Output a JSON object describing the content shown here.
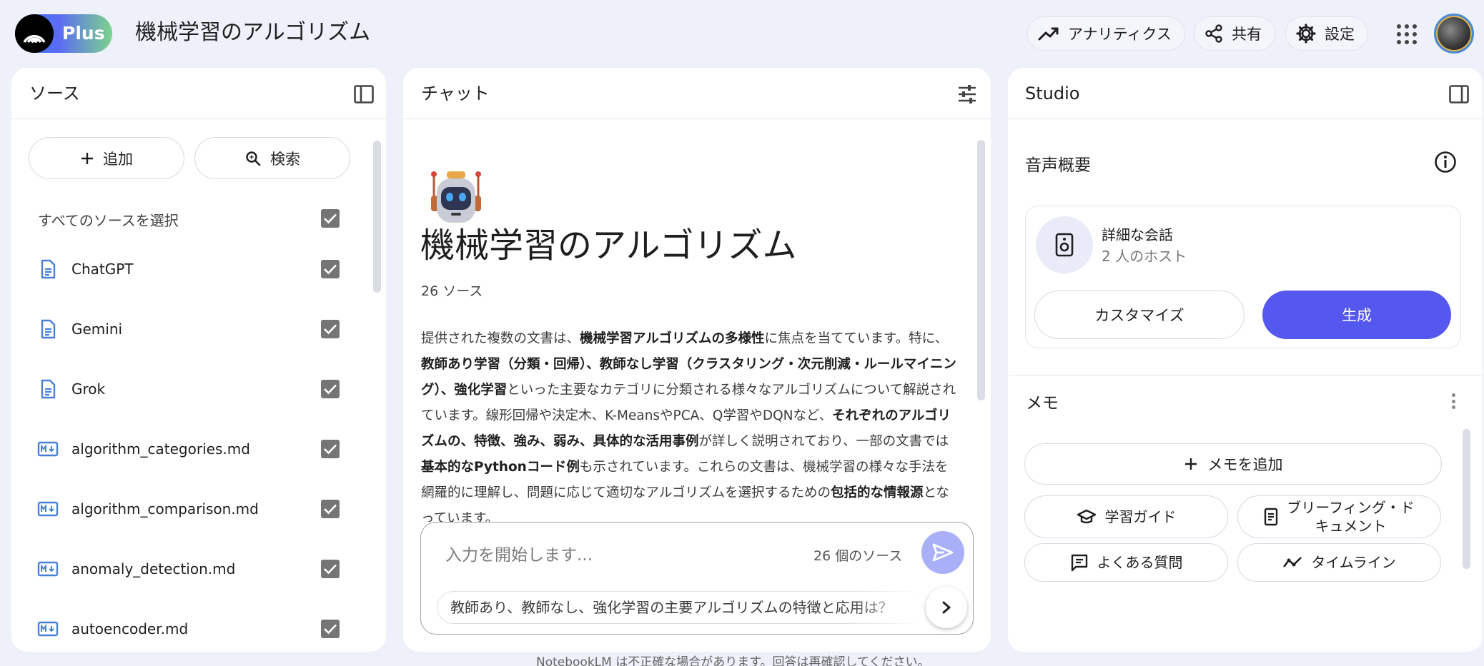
{
  "header": {
    "logo_text": "Plus",
    "title": "機械学習のアルゴリズム",
    "analytics_label": "アナリティクス",
    "share_label": "共有",
    "settings_label": "設定"
  },
  "sources": {
    "title": "ソース",
    "add_label": "追加",
    "search_label": "検索",
    "select_all_label": "すべてのソースを選択",
    "items": [
      {
        "name": "ChatGPT",
        "type": "doc"
      },
      {
        "name": "Gemini",
        "type": "doc"
      },
      {
        "name": "Grok",
        "type": "doc"
      },
      {
        "name": "algorithm_categories.md",
        "type": "md"
      },
      {
        "name": "algorithm_comparison.md",
        "type": "md"
      },
      {
        "name": "anomaly_detection.md",
        "type": "md"
      },
      {
        "name": "autoencoder.md",
        "type": "md"
      }
    ]
  },
  "chat": {
    "title": "チャット",
    "notebook_title": "機械学習のアルゴリズム",
    "source_count": "26 ソース",
    "summary": [
      {
        "t": "提供された複数の文書は、"
      },
      {
        "t": "機械学習アルゴリズムの多様性",
        "b": true
      },
      {
        "t": "に焦点を当てています。特に、"
      },
      {
        "t": "教師あり学習（分類・回帰）、教師なし学習（クラスタリング・次元削減・ルールマイニング）、強化学習",
        "b": true
      },
      {
        "t": "といった主要なカテゴリに分類される様々なアルゴリズムについて解説されています。線形回帰や決定木、K-MeansやPCA、Q学習やDQNなど、"
      },
      {
        "t": "それぞれのアルゴリズムの、特徴、強み、弱み、具体的な活用事例",
        "b": true
      },
      {
        "t": "が詳しく説明されており、一部の文書では"
      },
      {
        "t": "基本的なPythonコード例",
        "b": true
      },
      {
        "t": "も示されています。これらの文書は、機械学習の様々な手法を網羅的に理解し、問題に応じて適切なアルゴリズムを選択するための"
      },
      {
        "t": "包括的な情報源",
        "b": true
      },
      {
        "t": "となっています。"
      }
    ],
    "input_placeholder": "入力を開始します...",
    "input_source_count": "26 個のソース",
    "suggestion": "教師あり、教師なし、強化学習の主要アルゴリズムの特徴と応用は？",
    "footnote": "NotebookLM は不正確な場合があります。回答は再確認してください。"
  },
  "studio": {
    "title": "Studio",
    "audio_title": "音声概要",
    "audio_name": "詳細な会話",
    "audio_sub": "2 人のホスト",
    "customize_label": "カスタマイズ",
    "generate_label": "生成",
    "memo_title": "メモ",
    "add_memo_label": "メモを追加",
    "tools": {
      "study_guide": "学習ガイド",
      "briefing_line1": "ブリーフィング・ド",
      "briefing_line2": "キュメント",
      "faq": "よくある質問",
      "timeline": "タイムライン"
    }
  },
  "colors": {
    "accent": "#5558ee",
    "background": "#eef0fa",
    "file_icon": "#4a7fd6"
  }
}
